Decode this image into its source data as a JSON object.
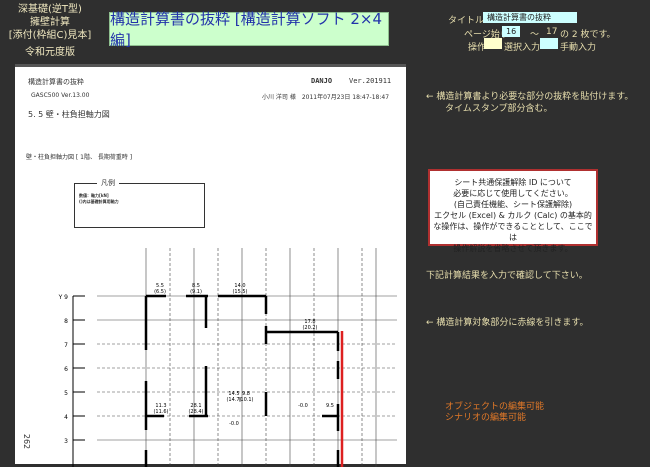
{
  "left_header": {
    "line1": "深基礎(逆T型)",
    "line2": "擁壁計算",
    "line3": "[添付(枠組C)見本]",
    "line4": "令和元度版"
  },
  "main_title": "構造計算書の抜粋 [構造計算ソフト 2×4 編]",
  "controls": {
    "title_label": "タイトル",
    "title_value": "構造計算書の抜粋",
    "page_label": "ページ始り",
    "page_start": "16",
    "tilde": "～",
    "page_end": "17",
    "page_suffix": "の 2 枚です。",
    "op_label": "操作",
    "select_label": "選択入力",
    "manual_label": "手動入力"
  },
  "document": {
    "header_left": "構造計算書の抜粋",
    "brand": "DANJO",
    "version": "Ver.201911",
    "software": "GASC500 Ver.13.00",
    "user_time": "小川 洋司 様　2011年07月23日 18:47-18:47",
    "section": "5. 5 壁・柱負担軸力図",
    "subtitle": "壁・柱負担軸力図 [ 1階、 長期荷重時 ]",
    "legend_title": "凡例",
    "legend_line1": "数値：軸力[kN]",
    "legend_line2": "()内は基礎計算用軸力",
    "page_number": "262",
    "y_labels": [
      "Y 9",
      "8",
      "7",
      "6",
      "5",
      "4",
      "3"
    ],
    "values": [
      "5.5\n(6.5)",
      "8.5\n(9.1)",
      "14.0\n(15.5)",
      "17.8\n(20.2)",
      "11.3\n(11.6)",
      "28.1\n(28.4)",
      "14.5\n(14.7)",
      "9.8\n(10.1)",
      "-0.0",
      "-0.0",
      "9.5"
    ]
  },
  "instructions": {
    "paste": "← 構造計算書より必要な部分の抜粋を貼付けます。",
    "timestamp": "タイムスタンプ部分含む。",
    "confirm": "下記計算結果を入力で確認して下さい。",
    "redline": "← 構造計算対象部分に赤線を引きます。",
    "obj_edit": "オブジェクトの編集可能",
    "scenario_edit": "シナリオの編集可能"
  },
  "notice": {
    "l1": "シート共通保護解除 ID について",
    "l2": "必要に応じて使用してください。",
    "l3": "(自己責任機能、シート保護解除)",
    "l4": "エクセル (Excel) & カルク (Calc) の基本的",
    "l5": "な操作は、操作ができることとして、ここでは",
    "l6": "操作解説を省略させて頂きます。"
  },
  "colors": {
    "title_bg": "#ccffcc",
    "title_text": "#2233aa",
    "select_fill": "#ffffcc",
    "manual_fill": "#ccffff",
    "red_line": "#dd2020"
  }
}
